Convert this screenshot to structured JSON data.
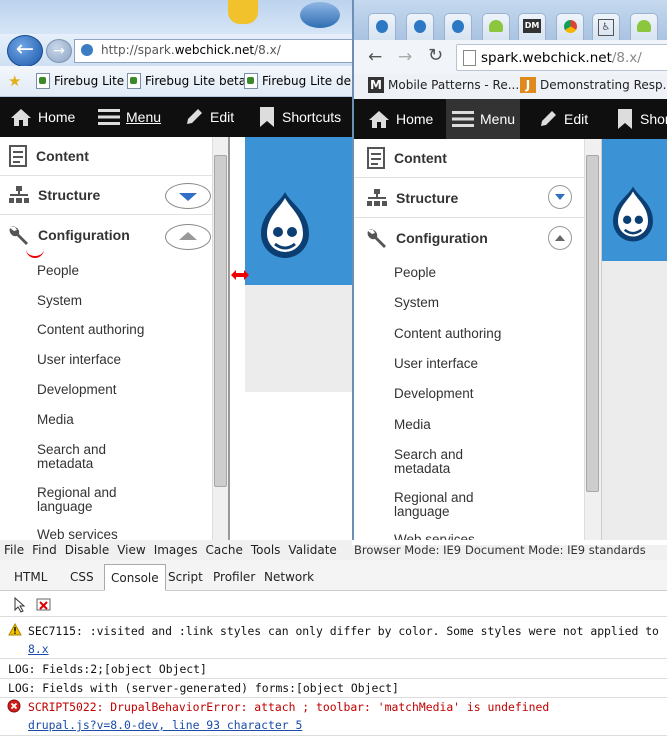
{
  "ie": {
    "url_prefix": "http://spark.",
    "url_domain": "webchick.net",
    "url_path": "/8.x/",
    "favorites": [
      "Firebug Lite",
      "Firebug Lite beta",
      "Firebug Lite debu"
    ],
    "nav_arrows": {
      "back": "←",
      "forward": "→"
    }
  },
  "toolbar_ie": {
    "home": "Home",
    "menu": "Menu",
    "edit": "Edit",
    "shortcuts": "Shortcuts"
  },
  "tray_ie": {
    "content": "Content",
    "structure": "Structure",
    "configuration": "Configuration",
    "items": [
      "People",
      "System",
      "Content authoring",
      "User interface",
      "Development",
      "Media",
      "Search and\nmetadata",
      "Regional and\nlanguage",
      "Web services"
    ]
  },
  "chrome": {
    "url_host": "spark.webchick.net",
    "url_path": "/8.x/",
    "bookmarks": [
      "Mobile Patterns - Re...",
      "Demonstrating Resp..."
    ],
    "bookmark_icons": [
      "M",
      "J"
    ],
    "tab_icons": [
      "drupal-favicon",
      "drupal-favicon",
      "drupal-favicon",
      "android-icon",
      "DM",
      "chrome-icon",
      "accessibility-icon",
      "android-icon"
    ],
    "dm_label": "DM"
  },
  "toolbar_cr": {
    "home": "Home",
    "menu": "Menu",
    "edit": "Edit",
    "shortcuts": "Shor"
  },
  "tray_cr": {
    "content": "Content",
    "structure": "Structure",
    "configuration": "Configuration",
    "items": [
      "People",
      "System",
      "Content authoring",
      "User interface",
      "Development",
      "Media",
      "Search and\nmetadata",
      "Regional and\nlanguage",
      "Web services"
    ]
  },
  "devtools": {
    "menu": [
      "File",
      "Find",
      "Disable",
      "View",
      "Images",
      "Cache",
      "Tools",
      "Validate"
    ],
    "browser_mode": "Browser Mode: IE9",
    "document_mode": "Document Mode: IE9 standards",
    "tabs": [
      "HTML",
      "CSS",
      "Console",
      "Script",
      "Profiler",
      "Network"
    ],
    "active_tab": "Console",
    "console": [
      {
        "type": "warn",
        "text": "SEC7115: :visited and :link styles can only differ by color. Some styles were not applied to",
        "link": "8.x"
      },
      {
        "type": "log",
        "text": "LOG: Fields:2;[object Object]"
      },
      {
        "type": "log",
        "text": "LOG: Fields with (server-generated) forms:[object Object]"
      },
      {
        "type": "error",
        "text": "SCRIPT5022: DrupalBehaviorError: attach ; toolbar: 'matchMedia' is undefined",
        "link": "drupal.js?v=8.0-dev, line 93 character 5"
      }
    ]
  },
  "colors": {
    "toolbar_bg": "#0f0f0f",
    "drupal_blue": "#3b93d6",
    "error_red": "#c00000",
    "link_blue": "#1a4ca8"
  }
}
